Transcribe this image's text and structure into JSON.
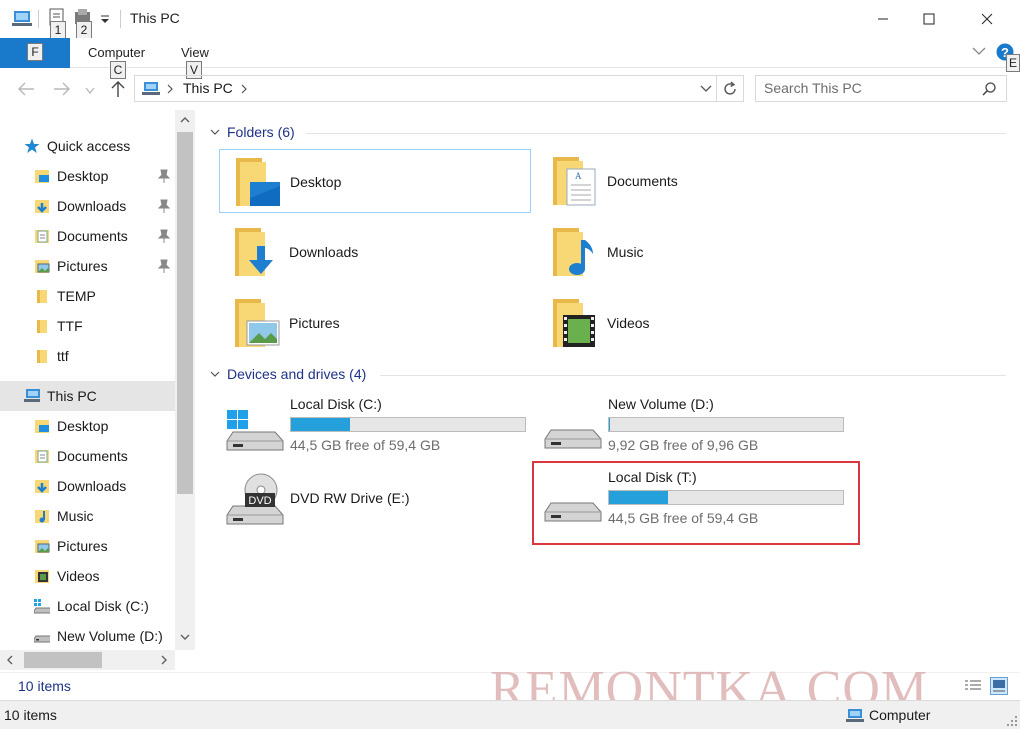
{
  "window": {
    "title": "This PC",
    "qa_keys": [
      "1",
      "2"
    ]
  },
  "ribbon": {
    "file_key": "F",
    "tabs": [
      {
        "label": "Computer",
        "key": "C"
      },
      {
        "label": "View",
        "key": "V"
      }
    ],
    "help_key": "E"
  },
  "address": {
    "path": "This PC",
    "search_placeholder": "Search This PC"
  },
  "nav": {
    "quick_access": "Quick access",
    "qa_items": [
      "Desktop",
      "Downloads",
      "Documents",
      "Pictures",
      "TEMP",
      "TTF",
      "ttf"
    ],
    "this_pc": "This PC",
    "pc_items": [
      "Desktop",
      "Documents",
      "Downloads",
      "Music",
      "Pictures",
      "Videos",
      "Local Disk (C:)",
      "New Volume (D:)"
    ]
  },
  "content": {
    "folders_header": "Folders (6)",
    "folders": [
      "Desktop",
      "Documents",
      "Downloads",
      "Music",
      "Pictures",
      "Videos"
    ],
    "drives_header": "Devices and drives (4)",
    "drives": [
      {
        "name": "Local Disk (C:)",
        "free": "44,5 GB free of 59,4 GB",
        "used_fraction": 0.25
      },
      {
        "name": "New Volume (D:)",
        "free": "9,92 GB free of 9,96 GB",
        "used_fraction": 0.004
      },
      {
        "name": "DVD RW Drive (E:)",
        "dvd_label": "DVD"
      },
      {
        "name": "Local Disk (T:)",
        "free": "44,5 GB free of 59,4 GB",
        "used_fraction": 0.25
      }
    ]
  },
  "status": {
    "items_top": "10 items",
    "items_bottom": "10 items",
    "location": "Computer"
  },
  "watermark": "REMONTKA.COM",
  "colors": {
    "accent": "#1979ca",
    "bar_fill": "#26a0da",
    "highlight": "#d9373e"
  }
}
